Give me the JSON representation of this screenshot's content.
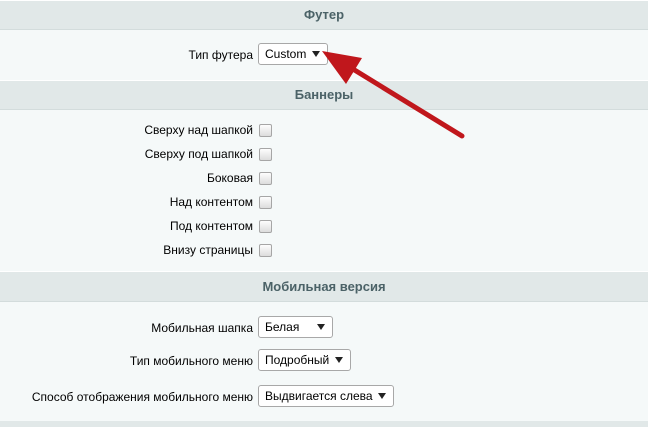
{
  "footer": {
    "header": "Футер",
    "type_label": "Тип футера",
    "type_value": "Custom"
  },
  "banners": {
    "header": "Баннеры",
    "items": [
      {
        "label": "Сверху над шапкой",
        "checked": false
      },
      {
        "label": "Сверху под шапкой",
        "checked": false
      },
      {
        "label": "Боковая",
        "checked": false
      },
      {
        "label": "Над контентом",
        "checked": false
      },
      {
        "label": "Под контентом",
        "checked": false
      },
      {
        "label": "Внизу страницы",
        "checked": false
      }
    ]
  },
  "mobile": {
    "header": "Мобильная версия",
    "header_style_label": "Мобильная шапка",
    "header_style_value": "Белая",
    "menu_type_label": "Тип мобильного меню",
    "menu_type_value": "Подробный",
    "menu_display_label": "Способ отображения мобильного меню",
    "menu_display_value": "Выдвигается слева"
  },
  "colors": {
    "header_bg": "#e1e8e8",
    "page_bg": "#f5f9f9",
    "annotation_arrow": "#c0171c"
  }
}
